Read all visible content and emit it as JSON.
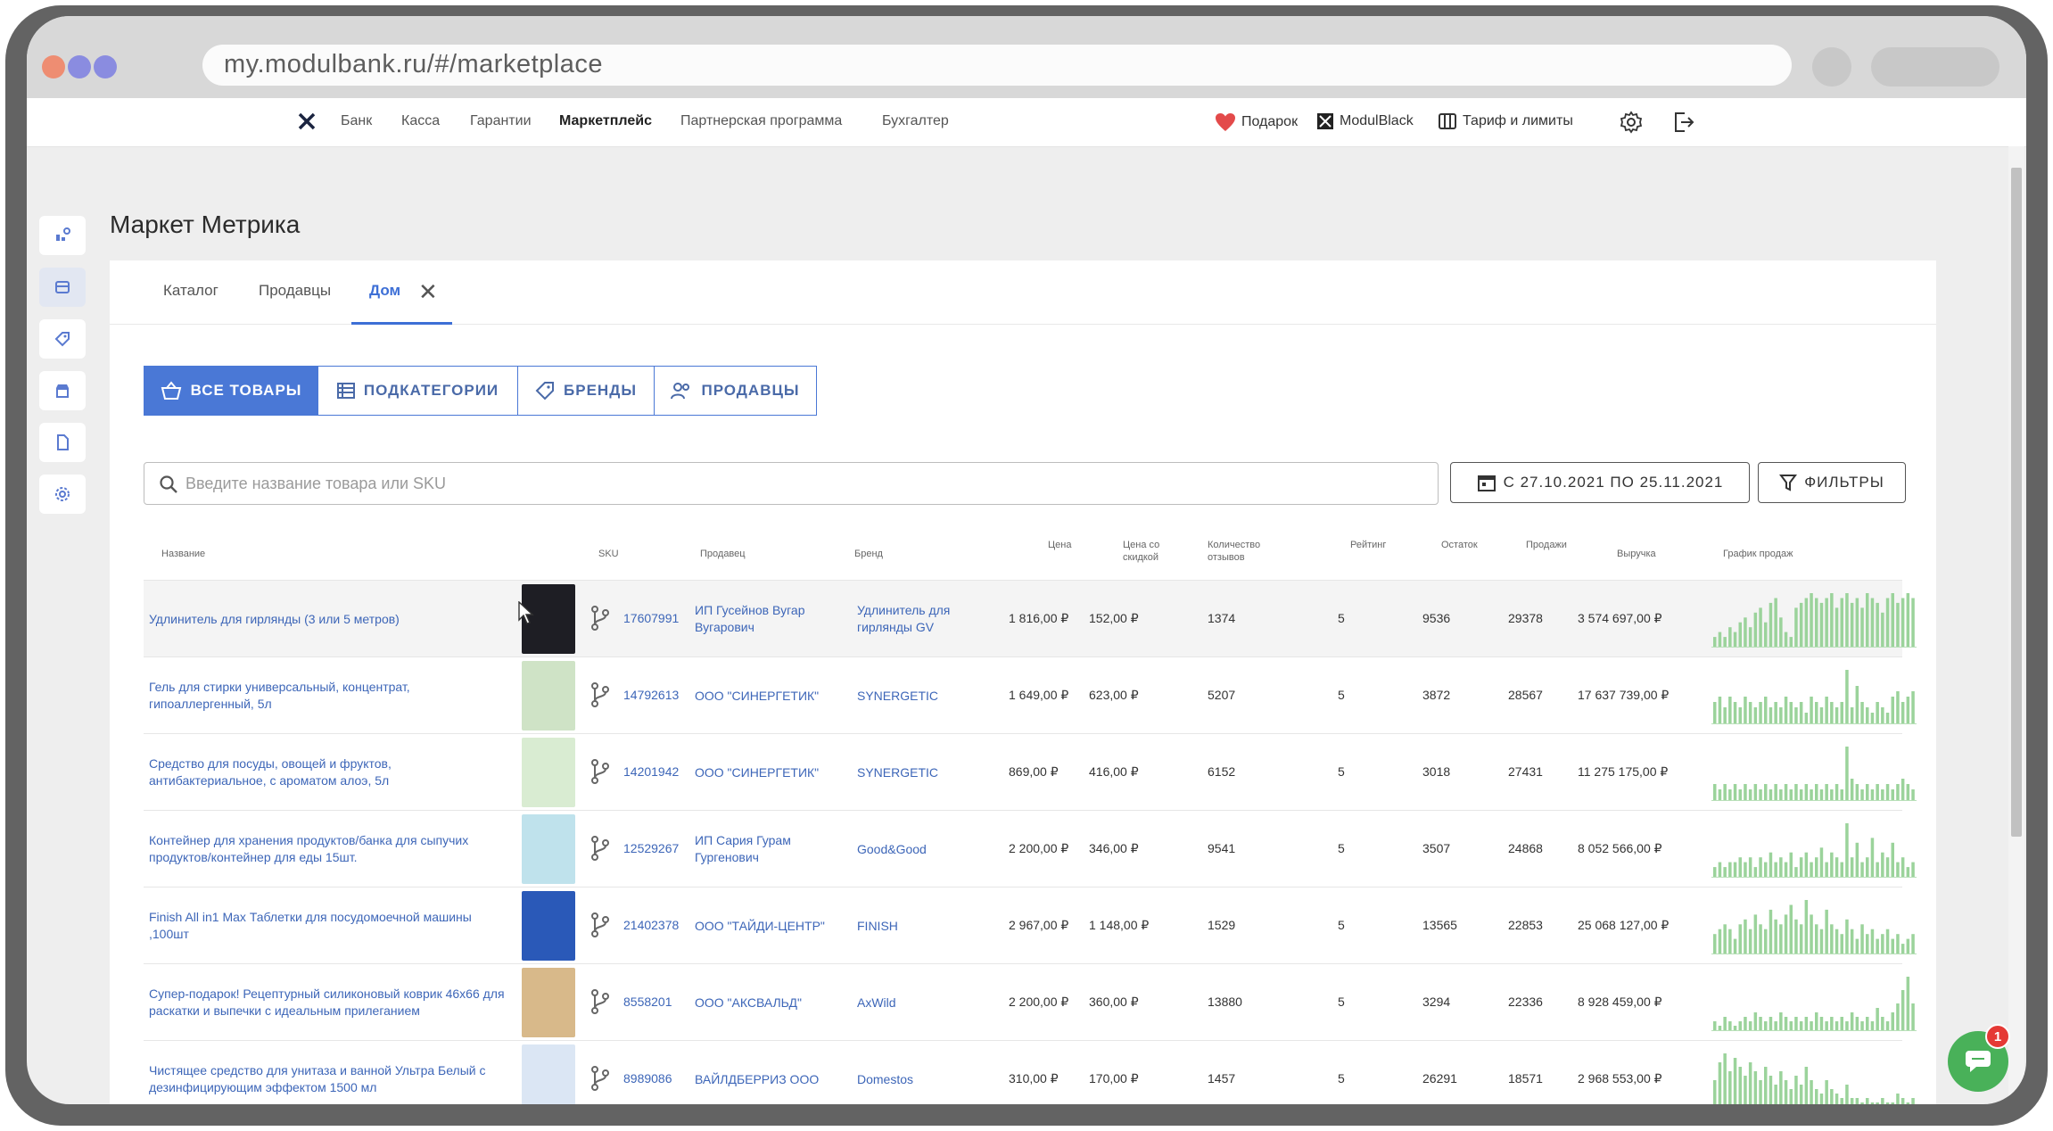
{
  "browser": {
    "url": "my.modulbank.ru/#/marketplace"
  },
  "topnav": {
    "items": [
      "Банк",
      "Касса",
      "Гарантии",
      "Маркетплейс",
      "Партнерская программа",
      "Бухгалтер"
    ],
    "active": "Маркетплейс",
    "gift": "Подарок",
    "black": "ModulBlack",
    "tariff": "Тариф и лимиты"
  },
  "page": {
    "title": "Маркет Метрика"
  },
  "tabs": [
    "Каталог",
    "Продавцы",
    "Дом"
  ],
  "segments": [
    "ВСЕ ТОВАРЫ",
    "ПОДКАТЕГОРИИ",
    "БРЕНДЫ",
    "ПРОДАВЦЫ"
  ],
  "search": {
    "placeholder": "Введите название товара или SKU"
  },
  "date_range": "С 27.10.2021 ПО 25.11.2021",
  "filters_label": "ФИЛЬТРЫ",
  "table": {
    "columns": {
      "name": "Название",
      "sku": "SKU",
      "seller": "Продавец",
      "brand": "Бренд",
      "price": "Цена",
      "discount": "Цена со скидкой",
      "reviews": "Количество отзывов",
      "rating": "Рейтинг",
      "stock": "Остаток",
      "sales": "Продажи",
      "revenue": "Выручка",
      "chart": "График продаж"
    },
    "rows": [
      {
        "name": "Удлинитель для гирлянды (3 или 5 метров)",
        "sku": "17607991",
        "seller": "ИП Гусейнов Вугар Вугарович",
        "brand": "Удлинитель для гирлянды GV",
        "price": "1 816,00 ₽",
        "discount": "152,00 ₽",
        "reviews": "1374",
        "rating": "5",
        "stock": "9536",
        "sales": "29378",
        "revenue": "3 574 697,00 ₽",
        "thumb_color": "#1e1e24",
        "spark": [
          2,
          3,
          2,
          4,
          3,
          5,
          6,
          4,
          7,
          8,
          5,
          9,
          10,
          6,
          3,
          2,
          8,
          9,
          10,
          11,
          10,
          9,
          10,
          11,
          8,
          10,
          11,
          9,
          10,
          8,
          11,
          10,
          9,
          7,
          10,
          11,
          9,
          10,
          11,
          10
        ]
      },
      {
        "name": "Гель для стирки универсальный, концентрат, гипоаллергенный, 5л",
        "sku": "14792613",
        "seller": "ООО \"СИНЕРГЕТИК\"",
        "brand": "SYNERGETIC",
        "price": "1 649,00 ₽",
        "discount": "623,00 ₽",
        "reviews": "5207",
        "rating": "5",
        "stock": "3872",
        "sales": "28567",
        "revenue": "17 637 739,00 ₽",
        "thumb_color": "#cfe3c6",
        "spark": [
          4,
          5,
          3,
          5,
          4,
          3,
          5,
          4,
          3,
          4,
          5,
          3,
          4,
          3,
          5,
          4,
          3,
          4,
          2,
          5,
          4,
          3,
          5,
          4,
          3,
          4,
          10,
          3,
          7,
          4,
          3,
          2,
          4,
          3,
          2,
          5,
          6,
          4,
          5,
          6
        ]
      },
      {
        "name": "Средство для посуды, овощей и фруктов, антибактериальное, с ароматом алоэ, 5л",
        "sku": "14201942",
        "seller": "ООО \"СИНЕРГЕТИК\"",
        "brand": "SYNERGETIC",
        "price": "869,00 ₽",
        "discount": "416,00 ₽",
        "reviews": "6152",
        "rating": "5",
        "stock": "3018",
        "sales": "27431",
        "revenue": "11 275 175,00 ₽",
        "thumb_color": "#d9ecd2",
        "spark": [
          3,
          2,
          3,
          2,
          3,
          2,
          3,
          2,
          3,
          2,
          3,
          2,
          3,
          2,
          3,
          2,
          3,
          2,
          3,
          2,
          3,
          2,
          3,
          2,
          3,
          2,
          10,
          4,
          3,
          2,
          3,
          2,
          3,
          2,
          3,
          2,
          3,
          4,
          3,
          2
        ]
      },
      {
        "name": "Контейнер для хранения продуктов/банка для сыпучих продуктов/контейнер для еды 15шт.",
        "sku": "12529267",
        "seller": "ИП Сария Гурам Гургенович",
        "brand": "Good&Good",
        "price": "2 200,00 ₽",
        "discount": "346,00 ₽",
        "reviews": "9541",
        "rating": "5",
        "stock": "3507",
        "sales": "24868",
        "revenue": "8 052 566,00 ₽",
        "thumb_color": "#bfe2ec",
        "spark": [
          2,
          3,
          2,
          3,
          3,
          4,
          3,
          4,
          2,
          4,
          3,
          5,
          3,
          4,
          3,
          5,
          2,
          4,
          5,
          3,
          4,
          6,
          3,
          5,
          4,
          3,
          11,
          4,
          7,
          3,
          4,
          8,
          3,
          5,
          4,
          7,
          3,
          4,
          2,
          3
        ]
      },
      {
        "name": "Finish All in1 Max Таблетки для посудомоечной машины ,100шт",
        "sku": "21402378",
        "seller": "ООО \"ТАЙДИ-ЦЕНТР\"",
        "brand": "FINISH",
        "price": "2 967,00 ₽",
        "discount": "1 148,00 ₽",
        "reviews": "1529",
        "rating": "5",
        "stock": "13565",
        "sales": "22853",
        "revenue": "25 068 127,00 ₽",
        "thumb_color": "#2a59b8",
        "spark": [
          4,
          5,
          6,
          5,
          3,
          6,
          7,
          5,
          8,
          6,
          5,
          9,
          7,
          6,
          8,
          10,
          7,
          6,
          11,
          8,
          6,
          5,
          9,
          6,
          5,
          4,
          7,
          5,
          3,
          6,
          4,
          5,
          3,
          4,
          5,
          3,
          4,
          2,
          3,
          4
        ]
      },
      {
        "name": "Супер-подарок! Рецептурный силиконовый коврик 46х66 для раскатки и выпечки с идеальным прилеганием",
        "sku": "8558201",
        "seller": "ООО \"АКСВАЛЬД\"",
        "brand": "AxWild",
        "price": "2 200,00 ₽",
        "discount": "360,00 ₽",
        "reviews": "13880",
        "rating": "5",
        "stock": "3294",
        "sales": "22336",
        "revenue": "8 928 459,00 ₽",
        "thumb_color": "#d8b98a",
        "spark": [
          2,
          1,
          3,
          2,
          1,
          2,
          3,
          2,
          4,
          3,
          2,
          3,
          2,
          4,
          3,
          2,
          3,
          2,
          3,
          2,
          4,
          3,
          2,
          3,
          2,
          3,
          2,
          4,
          3,
          2,
          3,
          2,
          5,
          3,
          2,
          4,
          6,
          9,
          12,
          6
        ]
      },
      {
        "name": "Чистящее средство для унитаза и ванной Ультра Белый с дезинфицирующим эффектом 1500 мл",
        "sku": "8989086",
        "seller": "ВАЙЛДБЕРРИЗ ООО",
        "brand": "Domestos",
        "price": "310,00 ₽",
        "discount": "170,00 ₽",
        "reviews": "1457",
        "rating": "5",
        "stock": "26291",
        "sales": "18571",
        "revenue": "2 968 553,00 ₽",
        "thumb_color": "#dbe6f4",
        "spark": [
          6,
          10,
          12,
          8,
          11,
          9,
          7,
          10,
          8,
          6,
          9,
          7,
          5,
          8,
          6,
          4,
          7,
          5,
          9,
          6,
          4,
          3,
          6,
          4,
          3,
          2,
          5,
          2,
          2,
          1,
          2,
          1,
          1,
          2,
          1,
          1,
          3,
          2,
          1,
          2
        ]
      }
    ]
  },
  "chat": {
    "badge": "1"
  },
  "colors": {
    "accent": "#4a78d6",
    "link": "#3d66b8",
    "spark": "#9bd39b"
  }
}
